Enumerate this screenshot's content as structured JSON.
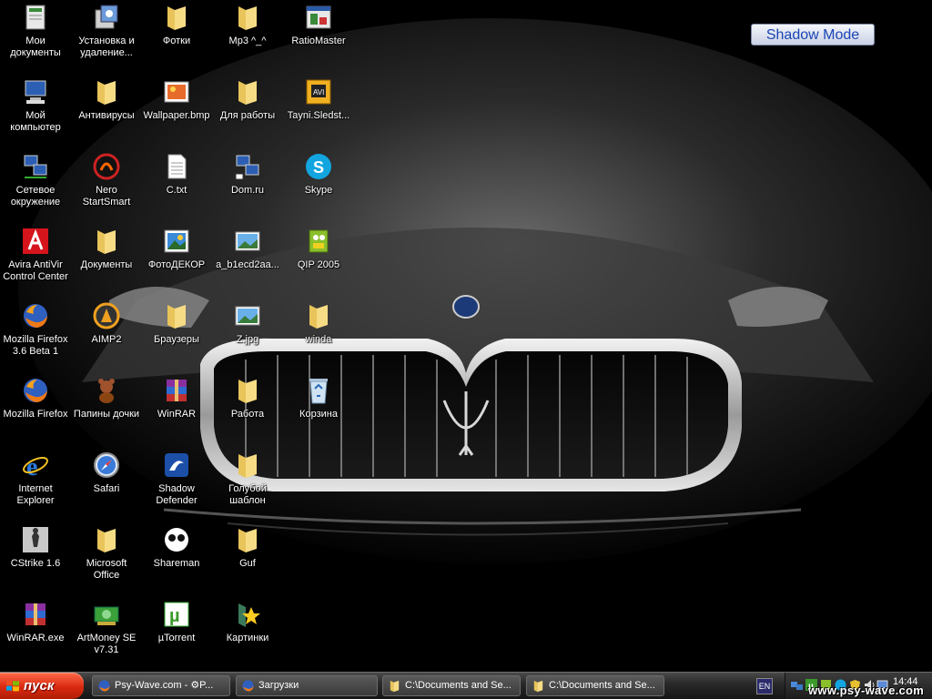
{
  "desktop": {
    "shadow_mode_label": "Shadow Mode",
    "icons": [
      {
        "label": "Мои документы",
        "icon": "my-documents-icon"
      },
      {
        "label": "Мой компьютер",
        "icon": "my-computer-icon"
      },
      {
        "label": "Сетевое окружение",
        "icon": "network-places-icon"
      },
      {
        "label": "Avira AntiVir Control Center",
        "icon": "avira-icon"
      },
      {
        "label": "Mozilla Firefox 3.6 Beta 1",
        "icon": "firefox-icon"
      },
      {
        "label": "Mozilla Firefox",
        "icon": "firefox-icon"
      },
      {
        "label": "Internet Explorer",
        "icon": "internet-explorer-icon"
      },
      {
        "label": "CStrike 1.6",
        "icon": "counter-strike-icon"
      },
      {
        "label": "WinRAR.exe",
        "icon": "winrar-icon"
      },
      {
        "label": "Установка и удаление...",
        "icon": "add-remove-programs-icon"
      },
      {
        "label": "Антивирусы",
        "icon": "folder-icon"
      },
      {
        "label": "Nero StartSmart",
        "icon": "nero-icon"
      },
      {
        "label": "Документы",
        "icon": "folder-icon"
      },
      {
        "label": "AIMP2",
        "icon": "aimp-icon"
      },
      {
        "label": "Папины дочки",
        "icon": "teddy-bear-icon"
      },
      {
        "label": "Safari",
        "icon": "safari-icon"
      },
      {
        "label": "Microsoft Office",
        "icon": "folder-icon"
      },
      {
        "label": "ArtMoney SE v7.31",
        "icon": "artmoney-icon"
      },
      {
        "label": "Фотки",
        "icon": "folder-icon"
      },
      {
        "label": "Wallpaper.bmp",
        "icon": "bitmap-image-icon"
      },
      {
        "label": "C.txt",
        "icon": "text-file-icon"
      },
      {
        "label": "ФотоДЕКОР",
        "icon": "photo-decor-icon"
      },
      {
        "label": "Браузеры",
        "icon": "folder-icon"
      },
      {
        "label": "WinRAR",
        "icon": "winrar-icon"
      },
      {
        "label": "Shadow Defender",
        "icon": "shadow-defender-icon"
      },
      {
        "label": "Shareman",
        "icon": "shareman-icon"
      },
      {
        "label": "µTorrent",
        "icon": "utorrent-icon"
      },
      {
        "label": "Mp3 ^_^",
        "icon": "folder-icon"
      },
      {
        "label": "Для работы",
        "icon": "folder-icon"
      },
      {
        "label": "Dom.ru",
        "icon": "network-shortcut-icon"
      },
      {
        "label": "a_b1ecd2aa...",
        "icon": "image-file-icon"
      },
      {
        "label": "Z.jpg",
        "icon": "image-file-icon"
      },
      {
        "label": "Работа",
        "icon": "folder-icon"
      },
      {
        "label": "Голубой шаблон",
        "icon": "folder-icon"
      },
      {
        "label": "Guf",
        "icon": "folder-icon"
      },
      {
        "label": "Картинки",
        "icon": "pictures-star-icon"
      },
      {
        "label": "RatioMaster",
        "icon": "ratiomaster-icon"
      },
      {
        "label": "Tayni.Sledst...",
        "icon": "avi-video-icon"
      },
      {
        "label": "Skype",
        "icon": "skype-icon"
      },
      {
        "label": "QIP 2005",
        "icon": "qip-icon"
      },
      {
        "label": "winda",
        "icon": "folder-icon"
      },
      {
        "label": "Корзина",
        "icon": "recycle-bin-icon"
      }
    ]
  },
  "taskbar": {
    "start_label": "пуск",
    "tasks": [
      {
        "label": "Psy-Wave.com - ⚙P...",
        "icon": "firefox-icon"
      },
      {
        "label": "Загрузки",
        "icon": "firefox-icon"
      },
      {
        "label": "C:\\Documents and Se...",
        "icon": "folder-icon"
      },
      {
        "label": "C:\\Documents and Se...",
        "icon": "folder-icon"
      }
    ],
    "language": "EN",
    "clock": "14:44"
  },
  "watermark": "www.psy-wave.com"
}
